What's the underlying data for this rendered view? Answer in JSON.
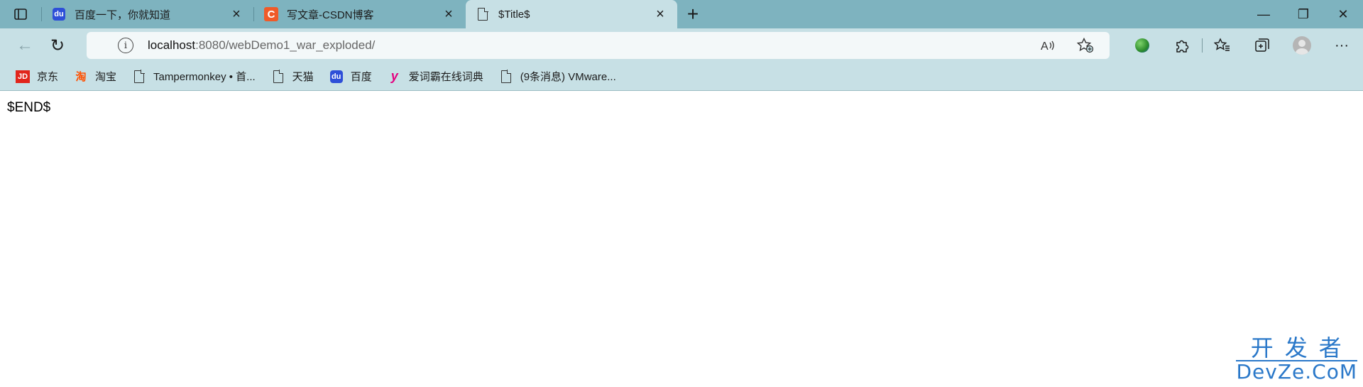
{
  "browser": {
    "tabs": [
      {
        "title": "百度一下，你就知道",
        "favicon": "baidu-paw-icon",
        "active": false
      },
      {
        "title": "写文章-CSDN博客",
        "favicon": "csdn-icon",
        "active": false
      },
      {
        "title": "$Title$",
        "favicon": "document-icon",
        "active": true
      }
    ],
    "new_tab_symbol": "+",
    "window_controls": {
      "minimize": "—",
      "restore": "❐",
      "close": "✕"
    },
    "toolbar": {
      "back_symbol": "←",
      "reload_symbol": "↻",
      "info_symbol": "i",
      "url_host": "localhost",
      "url_path": ":8080/webDemo1_war_exploded/",
      "read_aloud_symbol": "A",
      "favorite_add_symbol": "☆",
      "extensions_symbol": "⧉",
      "favorites_symbol": "☆",
      "collections_symbol": "⧉",
      "more_symbol": "···"
    },
    "bookmarks": [
      {
        "label": "京东",
        "icon": "jd-icon",
        "icon_text": "JD"
      },
      {
        "label": "淘宝",
        "icon": "taobao-icon",
        "icon_text": "淘"
      },
      {
        "label": "Tampermonkey • 首...",
        "icon": "document-icon"
      },
      {
        "label": "天猫",
        "icon": "document-icon"
      },
      {
        "label": "百度",
        "icon": "baidu-paw-icon"
      },
      {
        "label": "爱词霸在线词典",
        "icon": "iciba-icon",
        "icon_text": "y"
      },
      {
        "label": "(9条消息) VMware...",
        "icon": "document-icon"
      }
    ]
  },
  "page": {
    "body_text": "$END$"
  },
  "watermark": {
    "line1": "开发者",
    "line2": "DevZe.CoM"
  },
  "colors": {
    "tab_strip": "#7eb3bf",
    "toolbar": "#c7e0e5",
    "address_bar": "#f3f8f9",
    "watermark": "#2a78c9"
  }
}
